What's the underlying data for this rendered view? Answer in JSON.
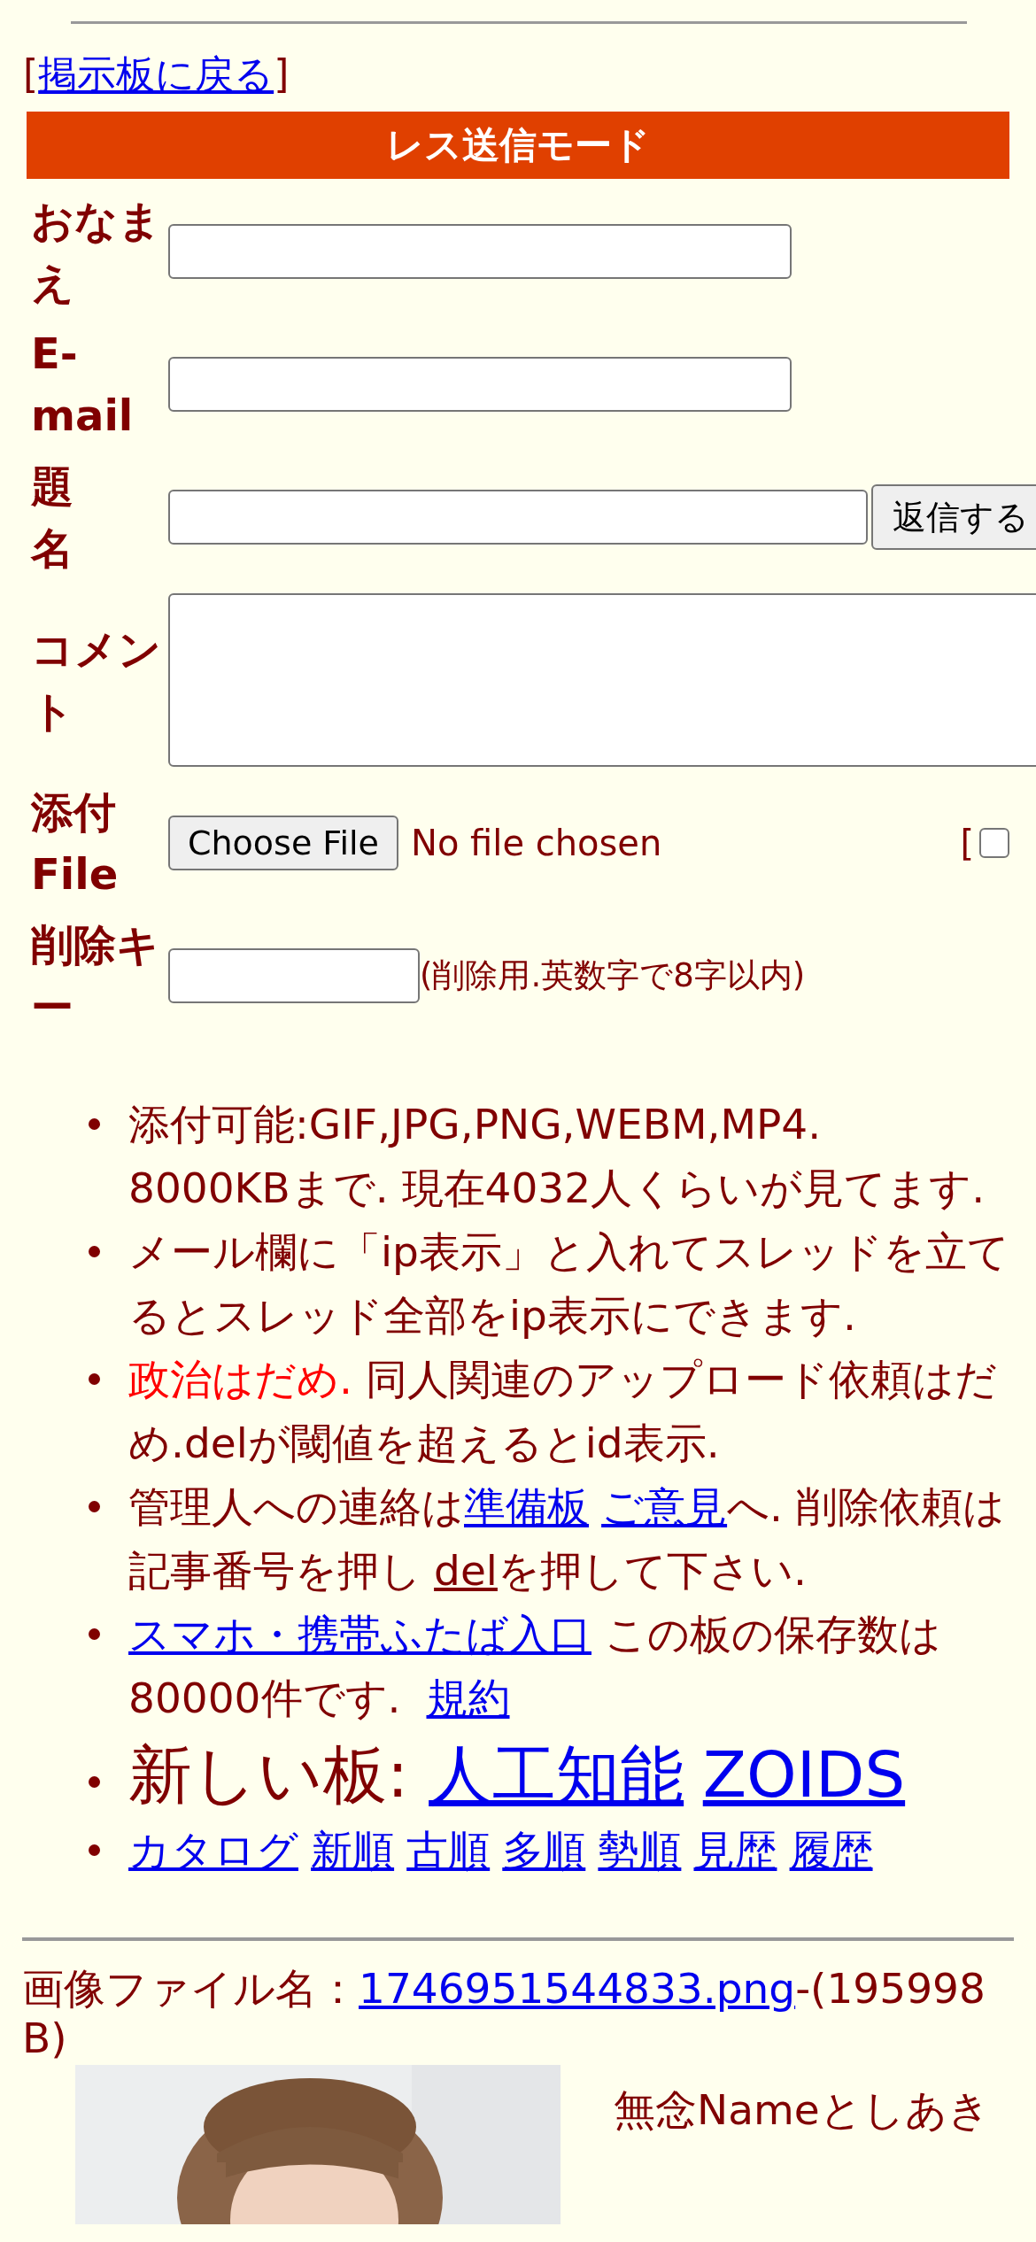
{
  "back_link": {
    "open": "[",
    "label": "掲示板に戻る",
    "close": "]"
  },
  "form": {
    "title": "レス送信モード",
    "fields": [
      {
        "kind": "text",
        "label": "おなまえ"
      },
      {
        "kind": "text",
        "label": "E-mail"
      },
      {
        "kind": "subject",
        "label": "題名",
        "button": "返信する"
      },
      {
        "kind": "textarea",
        "label": "コメント"
      },
      {
        "kind": "file",
        "label": "添付File",
        "button": "Choose File",
        "status": "No file chosen",
        "extra": "[",
        "checked": false
      },
      {
        "kind": "password",
        "label": "削除キー",
        "note": "(削除用.英数字で8字以内)"
      }
    ]
  },
  "notices": [
    {
      "kind": "normal",
      "parts": [
        {
          "kind": "plain",
          "text": "添付可能:GIF,JPG,PNG,WEBM,MP4.\n8000KBまで. 現在4032人くらいが見てます."
        }
      ]
    },
    {
      "kind": "normal",
      "parts": [
        {
          "kind": "plain",
          "text": "メール欄に「ip表示」と入れてスレッドを立てるとスレッド全部をip表示にできます."
        }
      ]
    },
    {
      "kind": "normal",
      "parts": [
        {
          "kind": "alert",
          "text": "政治はだめ."
        },
        {
          "kind": "plain",
          "text": " 同人関連のアップロード依頼はだめ.delが閾値を超えるとid表示."
        }
      ]
    },
    {
      "kind": "normal",
      "parts": [
        {
          "kind": "plain",
          "text": "管理人への連絡は"
        },
        {
          "kind": "link",
          "text": "準備板"
        },
        {
          "kind": "link",
          "text": "ご意見"
        },
        {
          "kind": "plain",
          "text": "へ. 削除依頼は記事番号を押し"
        },
        {
          "kind": "underline",
          "text": "del"
        },
        {
          "kind": "plain",
          "text": "を押して下さい."
        }
      ]
    },
    {
      "kind": "normal",
      "parts": [
        {
          "kind": "link",
          "text": "スマホ・携帯ふたば入口"
        },
        {
          "kind": "plain",
          "text": " この板の保存数は80000件です. "
        },
        {
          "kind": "link",
          "text": "規約"
        }
      ]
    },
    {
      "kind": "large",
      "parts": [
        {
          "kind": "plain",
          "text": "新しい板: "
        },
        {
          "kind": "link",
          "text": "人工知能"
        },
        {
          "kind": "link",
          "text": "ZOIDS"
        }
      ]
    },
    {
      "kind": "links",
      "parts": [
        {
          "kind": "link",
          "text": "カタログ"
        },
        {
          "kind": "link",
          "text": "新順"
        },
        {
          "kind": "link",
          "text": "古順"
        },
        {
          "kind": "link",
          "text": "多順"
        },
        {
          "kind": "link",
          "text": "勢順"
        },
        {
          "kind": "link",
          "text": "見歴"
        },
        {
          "kind": "link",
          "text": "履歴"
        }
      ]
    }
  ],
  "post": {
    "file_label": "画像ファイル名：",
    "file_name": "1746951544833.png",
    "file_size": "-(195998 B)",
    "header": "無念Nameとしあき"
  }
}
